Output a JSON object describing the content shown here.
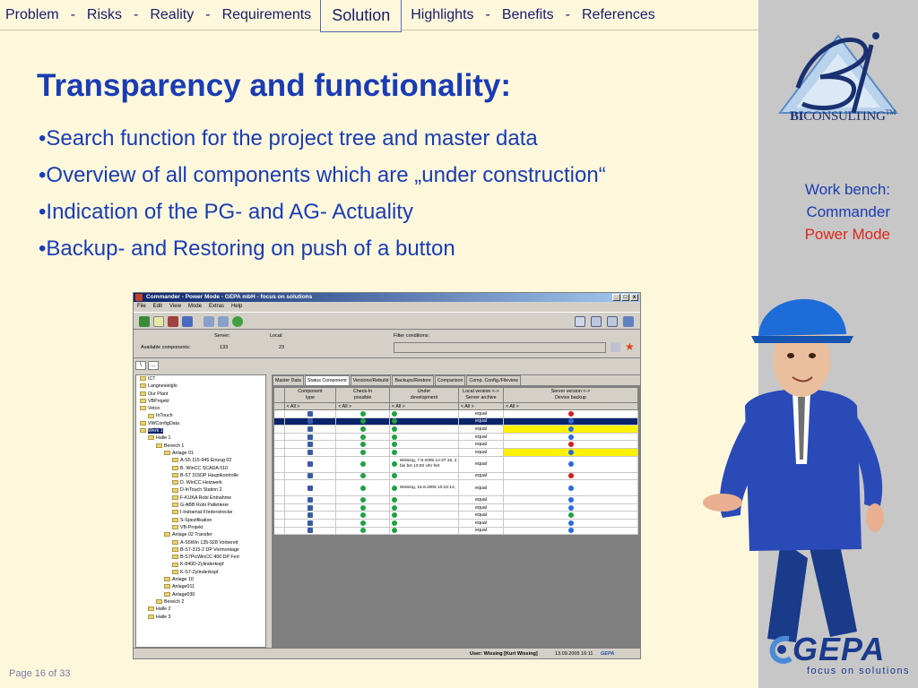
{
  "nav": {
    "items": [
      "Problem",
      "Risks",
      "Reality",
      "Requirements"
    ],
    "active": "Solution",
    "items_after": [
      "Highlights",
      "Benefits",
      "References"
    ],
    "separator": "-"
  },
  "slide": {
    "title": "Transparency and functionality:",
    "bullets": [
      "Search function for the project tree and master data",
      "Overview of all components which are „under construction“",
      "Indication of the PG- and AG- Actuality",
      "Backup- and Restoring on push of a button"
    ],
    "page": "Page 16 of 33"
  },
  "sidebar": {
    "logo_bi": "BI",
    "logo_consulting": "CONSULTING",
    "logo_tm": "TM",
    "workbench_line1": "Work bench:",
    "workbench_line2": "Commander",
    "workbench_line3": "Power Mode",
    "gepa_word": "GEPA",
    "gepa_tagline": "focus on solutions"
  },
  "app": {
    "title": "Commander - Power Mode - GEPA mbH - focus on solutions",
    "window_buttons": [
      "_",
      "□",
      "x"
    ],
    "menu": [
      "File",
      "Edit",
      "View",
      "Mode",
      "Extras",
      "Help"
    ],
    "info": {
      "server_label": "Server:",
      "local_label": "Local:",
      "filter_label": "Filter conditions:",
      "available_label": "Available components:",
      "available_server": "133",
      "available_local": "23"
    },
    "path_buttons": [
      "\\",
      "..."
    ],
    "tree": [
      {
        "label": "ICT",
        "indent": 0
      },
      {
        "label": "Langnesielglo",
        "indent": 0
      },
      {
        "label": "Our Plant",
        "indent": 0
      },
      {
        "label": "VBProjekt",
        "indent": 0
      },
      {
        "label": "Vetco",
        "indent": 0
      },
      {
        "label": "InTouch",
        "indent": 1
      },
      {
        "label": "VWConfigData",
        "indent": 0
      },
      {
        "label": "Werk 1",
        "indent": 0,
        "selected": true
      },
      {
        "label": "Halle 1",
        "indent": 1
      },
      {
        "label": "Bereich 1",
        "indent": 2
      },
      {
        "label": "Anlage 01",
        "indent": 3
      },
      {
        "label": "A-S5 115-945 Einzug 02",
        "indent": 4
      },
      {
        "label": "B. WinCC SCADA 010",
        "indent": 4
      },
      {
        "label": "B-S7 315DP Hauptkontrolle",
        "indent": 4
      },
      {
        "label": "D. WinCC Heizwerk",
        "indent": 4
      },
      {
        "label": "D-InTouch Station 2",
        "indent": 4
      },
      {
        "label": "F-KUKA Robi Entnahme",
        "indent": 4
      },
      {
        "label": "G-ABB Robi Palletierer",
        "indent": 4
      },
      {
        "label": "I-Indramat Förderstrecke",
        "indent": 4
      },
      {
        "label": "S-Spezifikation",
        "indent": 4
      },
      {
        "label": "VB-Projekt",
        "indent": 4
      },
      {
        "label": "Anlage 02 Transfer",
        "indent": 3
      },
      {
        "label": "A-S5Win 135-928 Vorbereit",
        "indent": 4
      },
      {
        "label": "B-S7-315-2 DP Vormontage",
        "indent": 4
      },
      {
        "label": "B-S7PicWinCC 400 DP Fert",
        "indent": 4
      },
      {
        "label": "K-840D-Zylinderkopf",
        "indent": 4
      },
      {
        "label": "K-S7-Zylinderkopf",
        "indent": 4
      },
      {
        "label": "Anlage 10",
        "indent": 3
      },
      {
        "label": "Anlage011",
        "indent": 3
      },
      {
        "label": "Anlage030",
        "indent": 3
      },
      {
        "label": "Bereich 2",
        "indent": 2
      },
      {
        "label": "Halle 2",
        "indent": 1
      },
      {
        "label": "Halle 3",
        "indent": 1
      }
    ],
    "tabs": [
      "Master Data",
      "Status Component",
      "Versions/Rebuild",
      "Backups/Restore",
      "Comparison",
      "Comp. Config./Fileview"
    ],
    "active_tab": "Status Component",
    "columns": [
      {
        "line1": "Component",
        "line2": "type"
      },
      {
        "line1": "Check-In",
        "line2": "possible"
      },
      {
        "line1": "Under",
        "line2": "development"
      },
      {
        "line1": "Local version <->",
        "line2": "Server archive"
      },
      {
        "line1": "Server version <->",
        "line2": "Device backup"
      }
    ],
    "filter_all": "< All >",
    "rows": [
      {
        "local": "equal",
        "server": "red"
      },
      {
        "local": "equal",
        "server": "blue",
        "selected": true
      },
      {
        "local": "equal",
        "server": "blue",
        "yellow": true
      },
      {
        "local": "equal",
        "server": "blue"
      },
      {
        "local": "equal",
        "server": "red"
      },
      {
        "local": "equal",
        "server": "blue",
        "yellow": true
      },
      {
        "local": "equal",
        "server": "blue",
        "note": "Wissing, 7.9.2005 14:37:19, 2 bin bis 13:00 Uhr fert"
      },
      {
        "local": "equal",
        "server": "red"
      },
      {
        "local": "equal",
        "server": "blue",
        "note": "Wissing, 15.8.2005 10:22:14,"
      },
      {
        "local": "equal",
        "server": "blue"
      },
      {
        "local": "equal",
        "server": "blue"
      },
      {
        "local": "equal",
        "server": "green"
      },
      {
        "local": "equal",
        "server": "blue"
      },
      {
        "local": "equal",
        "server": "blue"
      }
    ],
    "status": {
      "user": "User: Wissing [Kurt Wissing]",
      "date": "13.09.2005 16:11",
      "mini_logo": "GEPA"
    }
  },
  "colors": {
    "background": "#fdf8dc",
    "accent_blue": "#1a3cb4",
    "accent_red": "#e0251a",
    "sidebar_gray": "#c7c7c7"
  }
}
